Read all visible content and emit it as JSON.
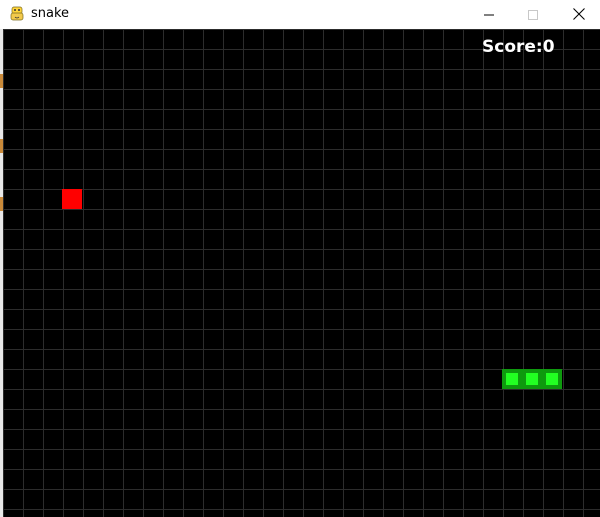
{
  "window": {
    "title": "snake",
    "app_icon": "python-icon",
    "controls": {
      "minimize_icon": "minimize-icon",
      "maximize_icon": "maximize-icon",
      "close_icon": "close-icon"
    }
  },
  "game": {
    "score_text": "Score:0",
    "background_color": "#000000",
    "grid_color": "#2c2c2c",
    "food_color": "#ff0000",
    "snake_color": "#22ff22",
    "snake_border_color": "#0e9a0e",
    "food_cell": [
      3,
      8
    ],
    "snake_cells": [
      [
        25,
        17
      ],
      [
        26,
        17
      ],
      [
        27,
        17
      ]
    ]
  }
}
